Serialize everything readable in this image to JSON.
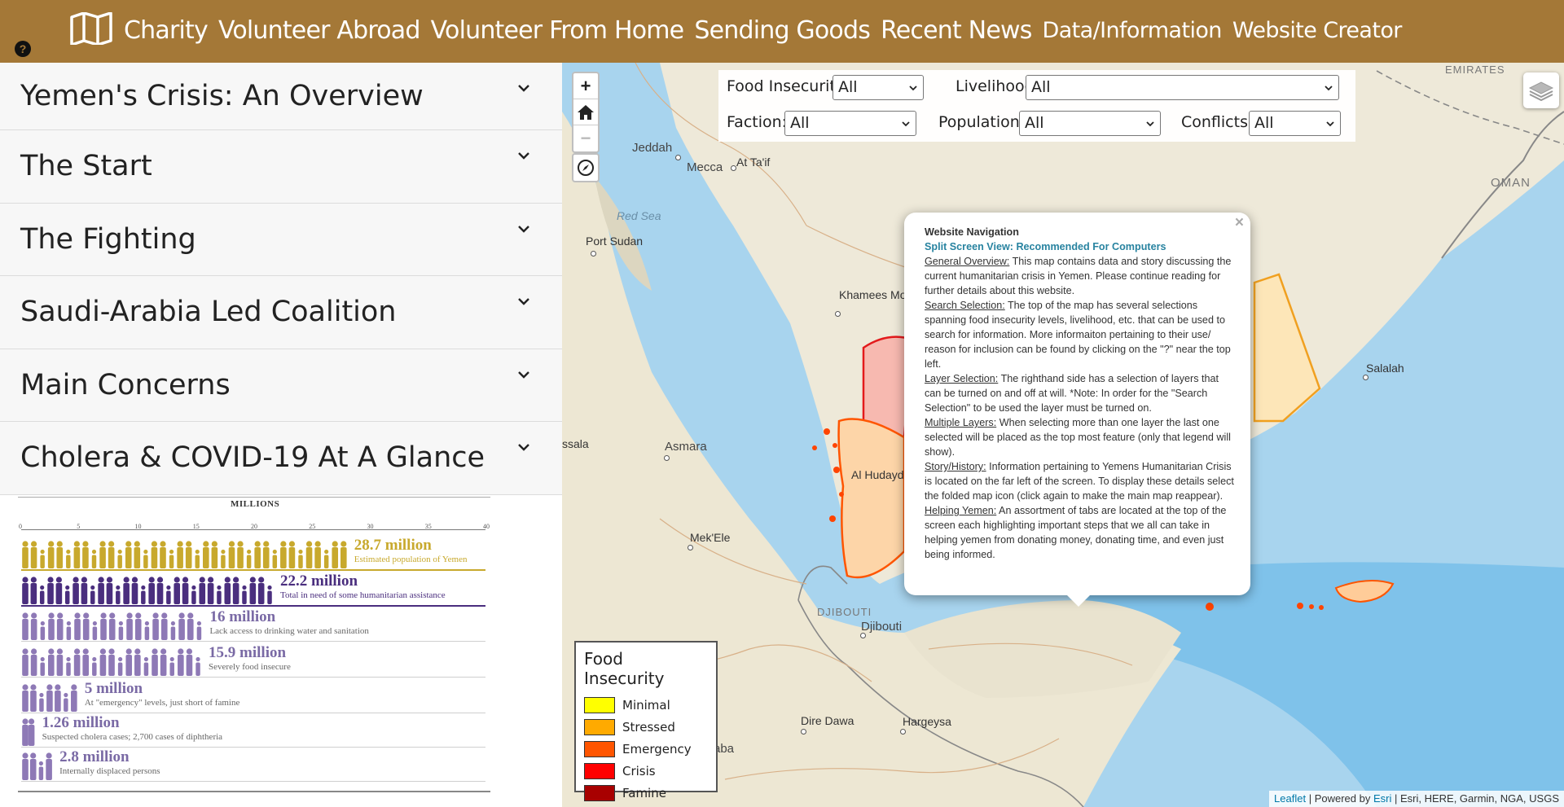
{
  "nav": {
    "help_icon": "?",
    "story_icon": "folded-map-icon",
    "links": [
      "Charity",
      "Volunteer Abroad",
      "Volunteer From Home",
      "Sending Goods",
      "Recent News",
      "Data/Information",
      "Website Creator"
    ],
    "color": "#a47837"
  },
  "sidebar": {
    "sections": [
      "Yemen's Crisis: An Overview",
      "The Start",
      "The Fighting",
      "Saudi-Arabia Led Coalition",
      "Main Concerns",
      "Cholera & COVID-19 At A Glance"
    ],
    "infographic": {
      "title": "MILLIONS",
      "ticks": [
        "0",
        "5",
        "10",
        "15",
        "20",
        "25",
        "30",
        "35",
        "40"
      ],
      "rows": [
        {
          "value": "28.7 million",
          "desc": "Estimated population of Yemen",
          "count": 28.7,
          "color": "#c8a92d"
        },
        {
          "value": "22.2 million",
          "desc": "Total in need of some humanitarian assistance",
          "count": 22.2,
          "color": "#4a2e7e"
        },
        {
          "value": "16 million",
          "desc": "Lack access to drinking water and sanitation",
          "count": 16,
          "color": "#8e79b6"
        },
        {
          "value": "15.9 million",
          "desc": "Severely food insecure",
          "count": 15.9,
          "color": "#8e79b6"
        },
        {
          "value": "5 million",
          "desc": "At \"emergency\" levels, just short of famine",
          "count": 5,
          "color": "#8e79b6"
        },
        {
          "value": "1.26 million",
          "desc": "Suspected cholera cases; 2,700 cases of diphtheria",
          "count": 1.26,
          "color": "#8e79b6"
        },
        {
          "value": "2.8 million",
          "desc": "Internally displaced persons",
          "count": 2.8,
          "color": "#8e79b6"
        }
      ]
    }
  },
  "map": {
    "zoom_in": "+",
    "zoom_out": "−",
    "home_icon": "home-icon",
    "locate_icon": "compass-icon",
    "layers_icon": "layers-icon",
    "filters": [
      {
        "label": "Food Insecurity:",
        "value": "All"
      },
      {
        "label": "Livelihood:",
        "value": "All"
      },
      {
        "label": "Faction:",
        "value": "All"
      },
      {
        "label": "Population:",
        "value": "All"
      },
      {
        "label": "Conflicts:",
        "value": "All"
      }
    ],
    "places": [
      "Jeddah",
      "Mecca",
      "At Ta'if",
      "Red Sea",
      "Port Sudan",
      "Khamees Moshait",
      "Asmara",
      "Mek'Ele",
      "Al Hudaydah",
      "DJIBOUTI",
      "Djibouti",
      "Dire Dawa",
      "Hargeysa",
      "Salalah",
      "OMAN",
      "EMIRATES",
      "ssala",
      "aba"
    ],
    "popup": {
      "close": "×",
      "heading": "Website Navigation",
      "subheading": "Split Screen View: Recommended For Computers",
      "items": [
        {
          "term": "General Overview:",
          "text": " This map contains data and story discussing the current humanitarian crisis in Yemen. Please continue reading for further details about this website."
        },
        {
          "term": "Search Selection:",
          "text": " The top of the map has several selections spanning food insecurity levels, livelihood, etc. that can be used to search for information. More informaiton pertaining to their use/ reason for inclusion can be found by clicking on the \"?\" near the top left."
        },
        {
          "term": "Layer Selection:",
          "text": " The righthand side has a selection of layers that can be turned on and off at will. *Note: In order for the \"Search Selection\" to be used the layer must be turned on."
        },
        {
          "term": "Multiple Layers:",
          "text": " When selecting more than one layer the last one selected will be placed as the top most feature (only that legend will show)."
        },
        {
          "term": "Story/History:",
          "text": " Information pertaining to Yemens Humanitarian Crisis is located on the far left of the screen. To display these details select the folded map icon (click again to make the main map reappear)."
        },
        {
          "term": "Helping Yemen:",
          "text": " An assortment of tabs are located at the top of the screen each highlighting important steps that we all can take in helping yemen from donating money, donating time, and even just being informed."
        }
      ]
    },
    "legend": {
      "title": "Food Insecurity",
      "items": [
        {
          "label": "Minimal",
          "color": "#ffff00"
        },
        {
          "label": "Stressed",
          "color": "#ffaa00"
        },
        {
          "label": "Emergency",
          "color": "#ff5500"
        },
        {
          "label": "Crisis",
          "color": "#ff0000"
        },
        {
          "label": "Famine",
          "color": "#a80000"
        }
      ]
    },
    "attribution": {
      "leaflet": "Leaflet",
      "powered": " | Powered by ",
      "esri": "Esri",
      "sources": " | Esri, HERE, Garmin, NGA, USGS"
    }
  }
}
